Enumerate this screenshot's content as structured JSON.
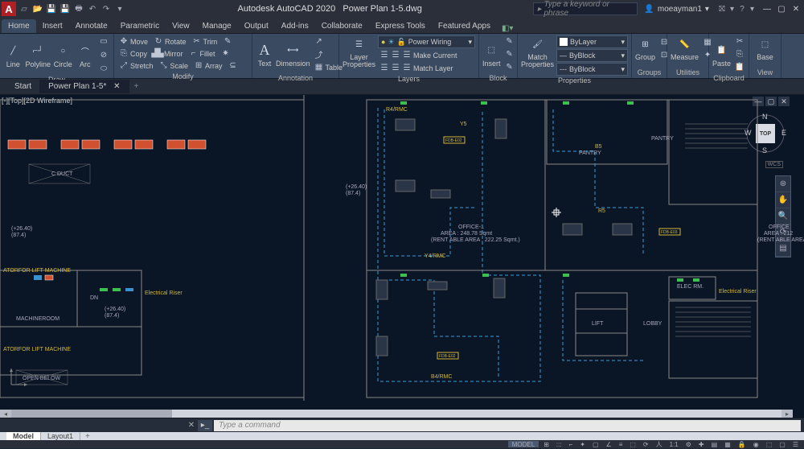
{
  "title": {
    "app": "Autodesk AutoCAD 2020",
    "file": "Power Plan 1-5.dwg"
  },
  "search": {
    "placeholder": "Type a keyword or phrase"
  },
  "user": {
    "name": "moeayman1"
  },
  "menu": {
    "tabs": [
      "Home",
      "Insert",
      "Annotate",
      "Parametric",
      "View",
      "Manage",
      "Output",
      "Add-ins",
      "Collaborate",
      "Express Tools",
      "Featured Apps"
    ],
    "active": 0
  },
  "ribbon": {
    "draw": {
      "label": "Draw",
      "items": [
        "Line",
        "Polyline",
        "Circle",
        "Arc"
      ]
    },
    "modify": {
      "label": "Modify",
      "row1": [
        {
          "i": "↔",
          "l": "Move"
        },
        {
          "i": "↻",
          "l": "Rotate"
        },
        {
          "i": "✂",
          "l": "Trim"
        }
      ],
      "row2": [
        {
          "i": "⎘",
          "l": "Copy"
        },
        {
          "i": "▟",
          "l": "Mirror"
        },
        {
          "i": "⌐",
          "l": "Fillet"
        }
      ],
      "row3": [
        {
          "i": "⤢",
          "l": "Stretch"
        },
        {
          "i": "⤡",
          "l": "Scale"
        },
        {
          "i": "⊞",
          "l": "Array"
        }
      ]
    },
    "annot": {
      "label": "Annotation",
      "text": "Text",
      "dim": "Dimension",
      "table": "Table"
    },
    "layers": {
      "label": "Layers",
      "lp": "Layer Properties",
      "dropdown": "Power Wiring",
      "mc": "Make Current",
      "ml": "Match Layer"
    },
    "block": {
      "label": "Block",
      "insert": "Insert"
    },
    "props": {
      "label": "Properties",
      "mp": "Match Properties",
      "d1": "ByLayer",
      "d2": "ByBlock",
      "d3": "ByBlock"
    },
    "groups": {
      "label": "Groups",
      "g": "Group"
    },
    "util": {
      "label": "Utilities",
      "m": "Measure"
    },
    "clip": {
      "label": "Clipboard",
      "p": "Paste"
    },
    "view": {
      "label": "View",
      "b": "Base"
    }
  },
  "filetabs": {
    "items": [
      "Start",
      "Power Plan 1-5*"
    ],
    "active": 1
  },
  "canvas": {
    "viewlabel": "[-][Top][2D Wireframe]",
    "cube": {
      "face": "TOP",
      "n": "N",
      "s": "S",
      "e": "E",
      "w": "W"
    },
    "wcs": "WCS",
    "labels": {
      "office": "OFFICE-1",
      "area1": "AREA : 248.78 Sqmt",
      "area2": "(RENT ABLE AREA : 222.25 Sqmt.)",
      "pantry": "PANTRY",
      "lobby": "LOBBY",
      "lift": "LIFT",
      "elecrm": "ELEC RM.",
      "elecriser": "Electrical Riser",
      "elecriser2": "Electrical Riser",
      "machine": "MACHINEROOM",
      "dn": "DN",
      "lift1": "ATORFOR LIFT MACHINE",
      "lift2": "ATORFOR LIFT MACHINE",
      "duct": "C DUCT",
      "openbelow": "OPEN BELOW",
      "r4": "R4/RMC",
      "y4": "Y4/RMC",
      "b4": "B4/RMC",
      "y5": "Y5",
      "r5": "R5",
      "b5": "B5",
      "fdb": "FDB-E02",
      "fdb2": "FDB-E02",
      "fdb3": "FDB-E03",
      "dim1": "(+26.40)",
      "dim2": "(+26.40)",
      "dim3": "(87.4)",
      "dim4": "(87.4)",
      "dim5": "(+26.40)",
      "side_office": "OFFICE",
      "side_area": "AREA : 212",
      "side_rent": "(RENT ABLE AREA"
    }
  },
  "cmd": {
    "placeholder": "Type a command"
  },
  "modeltabs": {
    "items": [
      "Model",
      "Layout1"
    ],
    "active": 0
  },
  "status": {
    "model": "MODEL",
    "scale": "1:1"
  }
}
